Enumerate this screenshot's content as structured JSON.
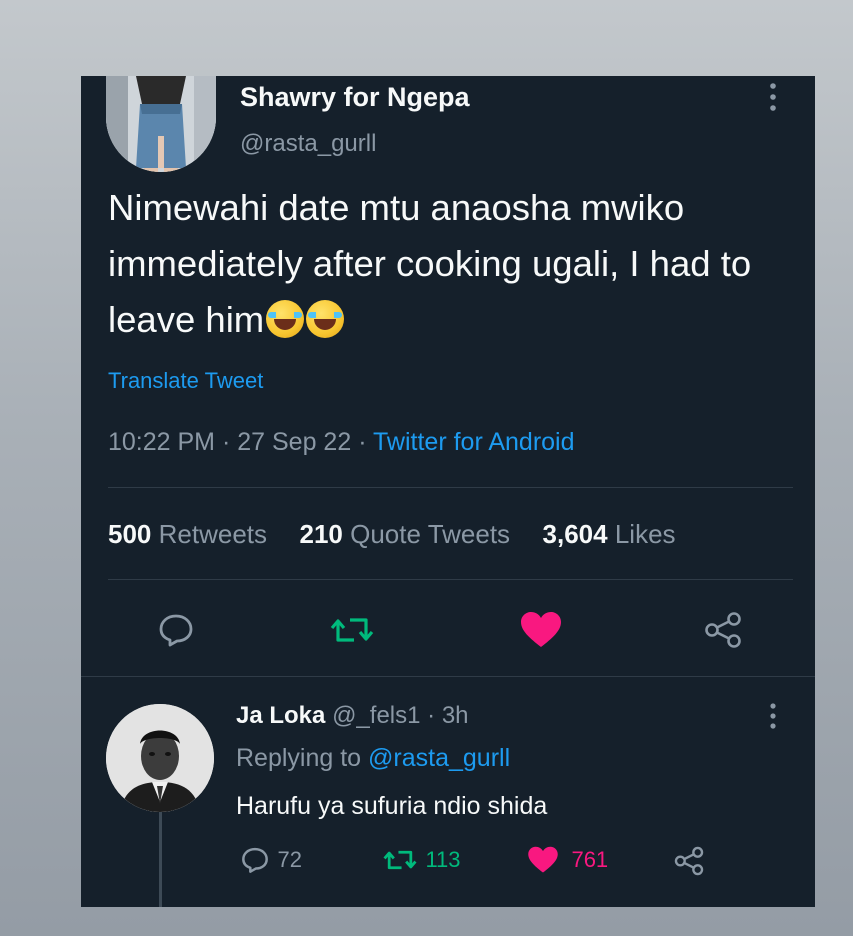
{
  "tweet": {
    "author_name": "Shawry for Ngepa",
    "author_handle": "@rasta_gurll",
    "more_label": "⋮",
    "text": "Nimewahi date mtu anaosha mwiko immediately after cooking ugali, I had to leave him",
    "emojis": [
      "😂",
      "😂"
    ],
    "translate_label": "Translate Tweet",
    "time": "10:22 PM",
    "date": "27 Sep 22",
    "separator": "·",
    "source": "Twitter for Android",
    "stats": {
      "retweets_count": "500",
      "retweets_label": "Retweets",
      "quotes_count": "210",
      "quotes_label": "Quote Tweets",
      "likes_count": "3,604",
      "likes_label": "Likes"
    },
    "actions": {
      "reply_icon": "reply-icon",
      "retweet_icon": "retweet-icon",
      "like_icon": "heart-icon",
      "share_icon": "share-icon"
    }
  },
  "reply": {
    "author_name": "Ja Loka",
    "author_handle": "@_fels1",
    "time": "3h",
    "separator": "·",
    "more_label": "⋮",
    "replying_label": "Replying to",
    "replying_to": "@rasta_gurll",
    "text": "Harufu ya sufuria ndio shida",
    "reply_count": "72",
    "retweet_count": "113",
    "like_count": "761"
  },
  "colors": {
    "background": "#15202b",
    "link": "#1d9bf0",
    "retweet_green": "#00ba7c",
    "like_pink": "#f91880",
    "secondary_text": "#8b98a5"
  }
}
